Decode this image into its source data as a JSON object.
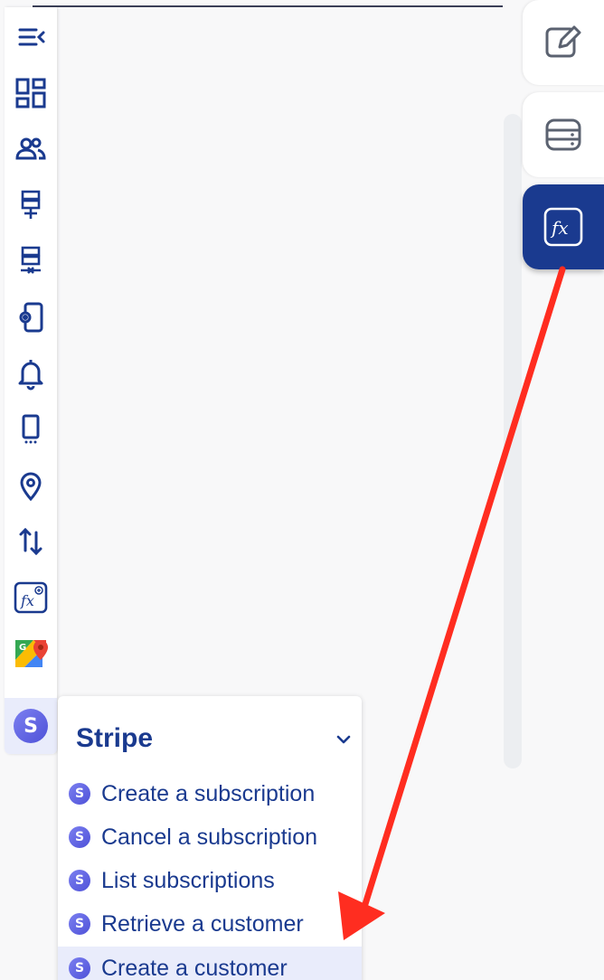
{
  "sidebar": {
    "icons": [
      "collapse-menu-icon",
      "dashboard-icon",
      "users-icon",
      "server-add-icon",
      "server-remove-icon",
      "device-settings-icon",
      "bell-icon",
      "mobile-icon",
      "location-pin-icon",
      "sort-arrows-icon",
      "function-add-icon",
      "google-maps-icon",
      "stripe-icon"
    ],
    "stripe_badge": "S"
  },
  "stripe_menu": {
    "title": "Stripe",
    "items": [
      {
        "label": "Create a subscription",
        "badge": "S"
      },
      {
        "label": "Cancel a subscription",
        "badge": "S"
      },
      {
        "label": "List subscriptions",
        "badge": "S"
      },
      {
        "label": "Retrieve a customer",
        "badge": "S"
      },
      {
        "label": "Create a customer",
        "badge": "S"
      }
    ]
  },
  "right_tabs": {
    "items": [
      "edit-icon",
      "database-icon",
      "function-icon"
    ],
    "active": "function-icon"
  },
  "colors": {
    "primary": "#1a3a8f",
    "highlight": "#e9ecfb",
    "annotation_arrow": "#ff2d20",
    "stripe_gradient": "#6366f1"
  }
}
